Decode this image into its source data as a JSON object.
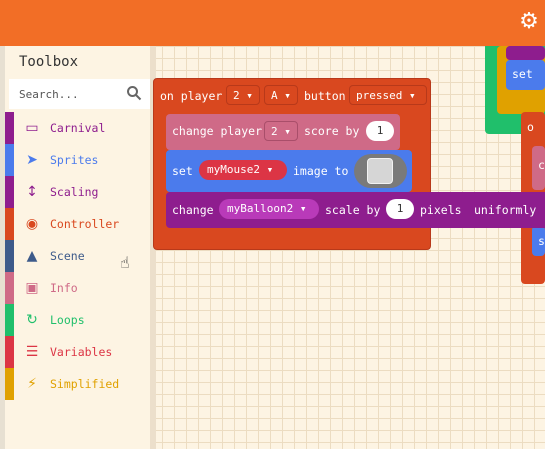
{
  "toolbox": {
    "title": "Toolbox",
    "search_placeholder": "Search...",
    "categories": [
      {
        "label": "Carnival",
        "color": "#8e1d8e",
        "text_color": "#8e1d8e",
        "icon": "carnival-icon",
        "glyph": "▭"
      },
      {
        "label": "Sprites",
        "color": "#4b7bec",
        "text_color": "#4b7bec",
        "icon": "paper-plane-icon",
        "glyph": "➤"
      },
      {
        "label": "Scaling",
        "color": "#8e1d8e",
        "text_color": "#8e1d8e",
        "icon": "vertical-arrows-icon",
        "glyph": "↕"
      },
      {
        "label": "Controller",
        "color": "#d9481f",
        "text_color": "#d9481f",
        "icon": "gamepad-icon",
        "glyph": "◉"
      },
      {
        "label": "Scene",
        "color": "#3d5a8a",
        "text_color": "#3d5a8a",
        "icon": "tree-icon",
        "glyph": "▲"
      },
      {
        "label": "Info",
        "color": "#cf6a87",
        "text_color": "#cf6a87",
        "icon": "id-card-icon",
        "glyph": "▣"
      },
      {
        "label": "Loops",
        "color": "#20bf6b",
        "text_color": "#20bf6b",
        "icon": "refresh-icon",
        "glyph": "↻"
      },
      {
        "label": "Variables",
        "color": "#dc3545",
        "text_color": "#dc3545",
        "icon": "list-icon",
        "glyph": "☰"
      },
      {
        "label": "Simplified",
        "color": "#e0a100",
        "text_color": "#e0a100",
        "icon": "lightning-icon",
        "glyph": "⚡"
      }
    ]
  },
  "blocks": {
    "event": {
      "prefix": "on player",
      "player": "2",
      "button_value": "A",
      "button_word": "button",
      "state": "pressed"
    },
    "score": {
      "prefix": "change player",
      "player": "2",
      "suffix": "score by",
      "value": "1"
    },
    "image": {
      "prefix": "set",
      "sprite": "myMouse2",
      "suffix": "image to"
    },
    "scale": {
      "prefix": "change",
      "sprite": "myBalloon2",
      "mid": "scale by",
      "value": "1",
      "units": "pixels",
      "mode": "uniformly"
    },
    "right_set": "set",
    "right_s": "s",
    "right_c": "c",
    "right_o": "o"
  },
  "colors": {
    "topbar": "#f26e26",
    "event": "#d9481f",
    "score": "#cf6a87",
    "image": "#4b7bec",
    "scale": "#8e1d8e"
  }
}
